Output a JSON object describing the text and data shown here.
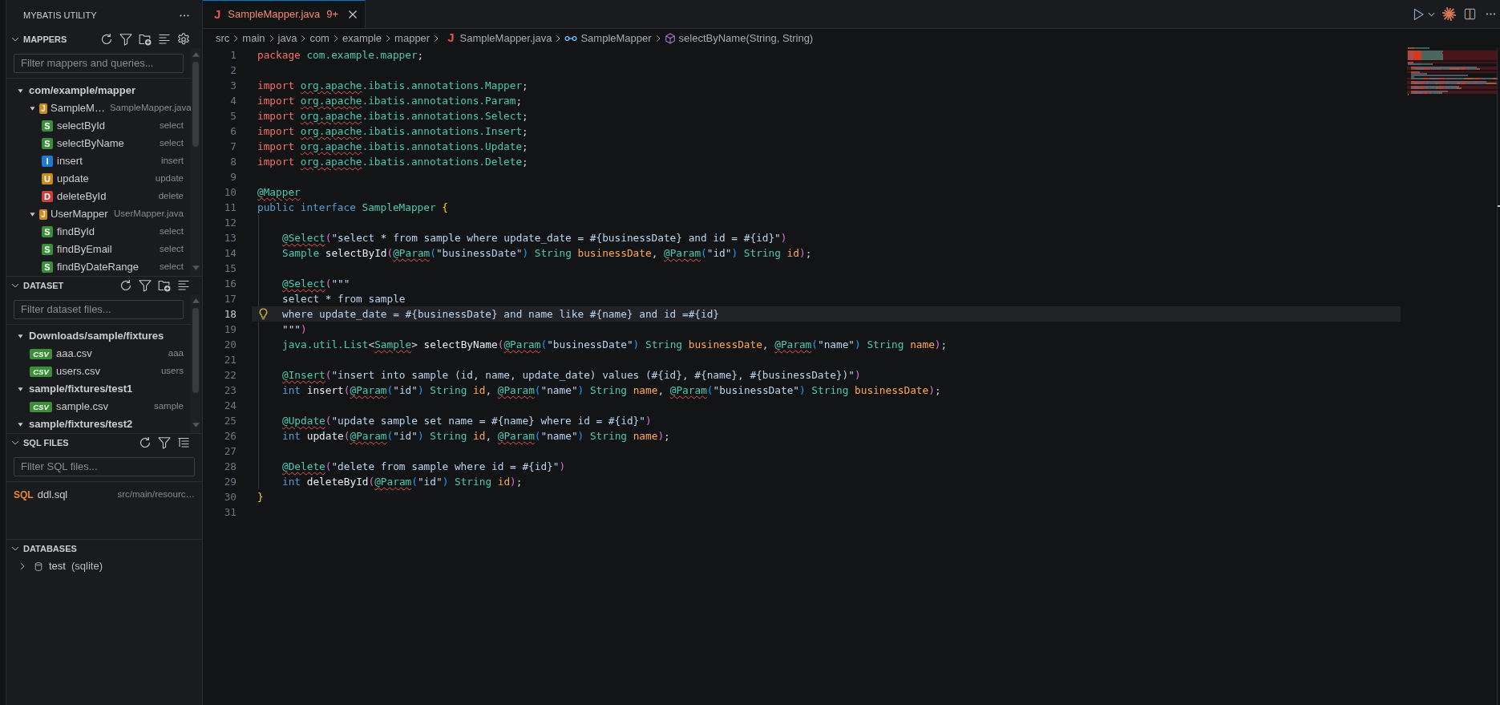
{
  "sidebar": {
    "title": "MYBATIS UTILITY",
    "sections": [
      {
        "kind": "mappers",
        "title": "MAPPERS",
        "expanded": true,
        "filter": {
          "placeholder": "Filter mappers and queries..."
        },
        "tree": [
          {
            "kind": "folder",
            "label": "com/example/mapper",
            "expanded": true,
            "children": [
              {
                "kind": "mapper",
                "badge": "J",
                "label": "SampleM…",
                "detail": "SampleMapper.java",
                "expanded": true,
                "children": [
                  {
                    "kind": "query",
                    "badge": "S",
                    "color": "#3b8e3b",
                    "label": "selectById",
                    "detail": "select"
                  },
                  {
                    "kind": "query",
                    "badge": "S",
                    "color": "#3b8e3b",
                    "label": "selectByName",
                    "detail": "select"
                  },
                  {
                    "kind": "query",
                    "badge": "I",
                    "color": "#1f78d1",
                    "label": "insert",
                    "detail": "insert"
                  },
                  {
                    "kind": "query",
                    "badge": "U",
                    "color": "#c98a1e",
                    "label": "update",
                    "detail": "update"
                  },
                  {
                    "kind": "query",
                    "badge": "D",
                    "color": "#c8413b",
                    "label": "deleteById",
                    "detail": "delete"
                  }
                ]
              },
              {
                "kind": "mapper",
                "badge": "J",
                "label": "UserMapper",
                "detail": "UserMapper.java",
                "expanded": true,
                "children": [
                  {
                    "kind": "query",
                    "badge": "S",
                    "color": "#3b8e3b",
                    "label": "findById",
                    "detail": "select"
                  },
                  {
                    "kind": "query",
                    "badge": "S",
                    "color": "#3b8e3b",
                    "label": "findByEmail",
                    "detail": "select"
                  },
                  {
                    "kind": "query",
                    "badge": "S",
                    "color": "#3b8e3b",
                    "label": "findByDateRange",
                    "detail": "select"
                  }
                ]
              }
            ]
          }
        ]
      },
      {
        "kind": "dataset",
        "title": "DATASET",
        "expanded": true,
        "filter": {
          "placeholder": "Filter dataset files..."
        },
        "tree": [
          {
            "kind": "folder",
            "label": "Downloads/sample/fixtures",
            "expanded": true,
            "children": [
              {
                "kind": "csv",
                "badge": "CSV",
                "label": "aaa.csv",
                "detail": "aaa"
              },
              {
                "kind": "csv",
                "badge": "CSV",
                "label": "users.csv",
                "detail": "users"
              }
            ]
          },
          {
            "kind": "folder",
            "label": "sample/fixtures/test1",
            "expanded": true,
            "children": [
              {
                "kind": "csv",
                "badge": "CSV",
                "label": "sample.csv",
                "detail": "sample"
              }
            ]
          },
          {
            "kind": "folder",
            "label": "sample/fixtures/test2",
            "expanded": true
          }
        ]
      },
      {
        "kind": "sqlfiles",
        "title": "SQL FILES",
        "expanded": true,
        "filter": {
          "placeholder": "Filter SQL files..."
        },
        "tree": [
          {
            "kind": "sql",
            "badge": "SQL",
            "label": "ddl.sql",
            "detail": "src/main/resourc…"
          }
        ]
      },
      {
        "kind": "databases",
        "title": "DATABASES",
        "expanded": true,
        "tree": [
          {
            "kind": "database",
            "label": "test",
            "detail": "(sqlite)",
            "expanded": false
          }
        ]
      }
    ]
  },
  "editor": {
    "tabs": [
      {
        "file_icon": "J",
        "title": "SampleMapper.java",
        "problems": "9+",
        "selected": true
      }
    ],
    "breadcrumbs": [
      {
        "kind": "folder",
        "label": "src"
      },
      {
        "kind": "folder",
        "label": "main"
      },
      {
        "kind": "folder",
        "label": "java"
      },
      {
        "kind": "folder",
        "label": "com"
      },
      {
        "kind": "folder",
        "label": "example"
      },
      {
        "kind": "folder",
        "label": "mapper"
      },
      {
        "kind": "file",
        "file_icon": "J",
        "label": "SampleMapper.java"
      },
      {
        "kind": "interface",
        "label": "SampleMapper"
      },
      {
        "kind": "method",
        "label": "selectByName(String, String)"
      }
    ],
    "lines": [
      {
        "number": "1",
        "current": false,
        "lightbulb": false,
        "tokens": [
          {
            "text": "package ",
            "kind": "keyword"
          },
          {
            "text": "com.example.mapper",
            "kind": "namespace"
          },
          {
            "text": ";",
            "kind": "plain"
          }
        ]
      },
      {
        "number": "2",
        "current": false,
        "lightbulb": false
      },
      {
        "number": "3",
        "current": false,
        "lightbulb": false,
        "tokens": [
          {
            "text": "import ",
            "kind": "keyword"
          },
          {
            "text": "org.apache",
            "kind": "unresolved"
          },
          {
            "text": ".ibatis.annotations.Mapper",
            "kind": "namespace"
          },
          {
            "text": ";",
            "kind": "plain"
          }
        ]
      },
      {
        "number": "4",
        "current": false,
        "lightbulb": false,
        "tokens": [
          {
            "text": "import ",
            "kind": "keyword"
          },
          {
            "text": "org.apache",
            "kind": "unresolved"
          },
          {
            "text": ".ibatis.annotations.Param",
            "kind": "namespace"
          },
          {
            "text": ";",
            "kind": "plain"
          }
        ]
      },
      {
        "number": "5",
        "current": false,
        "lightbulb": false,
        "tokens": [
          {
            "text": "import ",
            "kind": "keyword"
          },
          {
            "text": "org.apache",
            "kind": "unresolved"
          },
          {
            "text": ".ibatis.annotations.Select",
            "kind": "namespace"
          },
          {
            "text": ";",
            "kind": "plain"
          }
        ]
      },
      {
        "number": "6",
        "current": false,
        "lightbulb": false,
        "tokens": [
          {
            "text": "import ",
            "kind": "keyword"
          },
          {
            "text": "org.apache",
            "kind": "unresolved"
          },
          {
            "text": ".ibatis.annotations.Insert",
            "kind": "namespace"
          },
          {
            "text": ";",
            "kind": "plain"
          }
        ]
      },
      {
        "number": "7",
        "current": false,
        "lightbulb": false,
        "tokens": [
          {
            "text": "import ",
            "kind": "keyword"
          },
          {
            "text": "org.apache",
            "kind": "unresolved"
          },
          {
            "text": ".ibatis.annotations.Update",
            "kind": "namespace"
          },
          {
            "text": ";",
            "kind": "plain"
          }
        ]
      },
      {
        "number": "8",
        "current": false,
        "lightbulb": false,
        "tokens": [
          {
            "text": "import ",
            "kind": "keyword"
          },
          {
            "text": "org.apache",
            "kind": "unresolved"
          },
          {
            "text": ".ibatis.annotations.Delete",
            "kind": "namespace"
          },
          {
            "text": ";",
            "kind": "plain"
          }
        ]
      },
      {
        "number": "9",
        "current": false,
        "lightbulb": false
      },
      {
        "number": "10",
        "current": false,
        "lightbulb": false,
        "tokens": [
          {
            "text": "@Mapper",
            "kind": "unresolved"
          }
        ]
      },
      {
        "number": "11",
        "current": false,
        "lightbulb": false,
        "tokens": [
          {
            "text": "public interface ",
            "kind": "storage"
          },
          {
            "text": "SampleMapper ",
            "kind": "type"
          },
          {
            "text": "{",
            "kind": "bracket1"
          }
        ],
        "children": [
          {
            "number": "12",
            "current": false,
            "lightbulb": false
          },
          {
            "number": "13",
            "current": false,
            "lightbulb": false,
            "tokens": [
              {
                "text": "@Select",
                "kind": "unresolved"
              },
              {
                "text": "(",
                "kind": "bracket2"
              },
              {
                "text": "\"select * from sample where update_date = #{businessDate} and id = #{id}\"",
                "kind": "string"
              },
              {
                "text": ")",
                "kind": "bracket2"
              }
            ]
          },
          {
            "number": "14",
            "current": false,
            "lightbulb": false,
            "tokens": [
              {
                "text": "Sample ",
                "kind": "type"
              },
              {
                "text": "selectById",
                "kind": "method"
              },
              {
                "text": "(",
                "kind": "bracket2"
              },
              {
                "text": "@Param",
                "kind": "unresolved"
              },
              {
                "text": "(",
                "kind": "bracket3"
              },
              {
                "text": "\"businessDate\"",
                "kind": "string"
              },
              {
                "text": ")",
                "kind": "bracket3"
              },
              {
                "text": " String ",
                "kind": "type"
              },
              {
                "text": "businessDate",
                "kind": "param"
              },
              {
                "text": ", ",
                "kind": "plain"
              },
              {
                "text": "@Param",
                "kind": "unresolved"
              },
              {
                "text": "(",
                "kind": "bracket3"
              },
              {
                "text": "\"id\"",
                "kind": "string"
              },
              {
                "text": ")",
                "kind": "bracket3"
              },
              {
                "text": " String ",
                "kind": "type"
              },
              {
                "text": "id",
                "kind": "param"
              },
              {
                "text": ")",
                "kind": "bracket2"
              },
              {
                "text": ";",
                "kind": "plain"
              }
            ]
          },
          {
            "number": "15",
            "current": false,
            "lightbulb": false
          },
          {
            "number": "16",
            "current": false,
            "lightbulb": false,
            "tokens": [
              {
                "text": "@Select",
                "kind": "unresolved"
              },
              {
                "text": "(",
                "kind": "bracket2"
              },
              {
                "text": "\"\"\"",
                "kind": "string"
              }
            ]
          },
          {
            "number": "17",
            "current": false,
            "lightbulb": false,
            "tokens": [
              {
                "text": "select * from sample",
                "kind": "string"
              }
            ]
          },
          {
            "number": "18",
            "current": true,
            "lightbulb": true,
            "tokens": [
              {
                "text": "where update_date = #{businessDate} and name like #{name} and id =#{id}",
                "kind": "string"
              }
            ]
          },
          {
            "number": "19",
            "current": false,
            "lightbulb": false,
            "tokens": [
              {
                "text": "\"\"\"",
                "kind": "string"
              },
              {
                "text": ")",
                "kind": "bracket2"
              }
            ]
          },
          {
            "number": "20",
            "current": false,
            "lightbulb": false,
            "tokens": [
              {
                "text": "java.util.List",
                "kind": "type"
              },
              {
                "text": "<",
                "kind": "plain"
              },
              {
                "text": "Sample",
                "kind": "unresolved"
              },
              {
                "text": "> ",
                "kind": "plain"
              },
              {
                "text": "selectByName",
                "kind": "method"
              },
              {
                "text": "(",
                "kind": "bracket2"
              },
              {
                "text": "@Param",
                "kind": "unresolved"
              },
              {
                "text": "(",
                "kind": "bracket3"
              },
              {
                "text": "\"businessDate\"",
                "kind": "string"
              },
              {
                "text": ")",
                "kind": "bracket3"
              },
              {
                "text": " String ",
                "kind": "type"
              },
              {
                "text": "businessDate",
                "kind": "param"
              },
              {
                "text": ", ",
                "kind": "plain"
              },
              {
                "text": "@Param",
                "kind": "unresolved"
              },
              {
                "text": "(",
                "kind": "bracket3"
              },
              {
                "text": "\"name\"",
                "kind": "string"
              },
              {
                "text": ")",
                "kind": "bracket3"
              },
              {
                "text": " String ",
                "kind": "type"
              },
              {
                "text": "name",
                "kind": "param"
              },
              {
                "text": ")",
                "kind": "bracket2"
              },
              {
                "text": ";",
                "kind": "plain"
              }
            ]
          },
          {
            "number": "21",
            "current": false,
            "lightbulb": false
          },
          {
            "number": "22",
            "current": false,
            "lightbulb": false,
            "tokens": [
              {
                "text": "@Insert",
                "kind": "unresolved"
              },
              {
                "text": "(",
                "kind": "bracket2"
              },
              {
                "text": "\"insert into sample (id, name, update_date) values (#{id}, #{name}, #{businessDate})\"",
                "kind": "string"
              },
              {
                "text": ")",
                "kind": "bracket2"
              }
            ]
          },
          {
            "number": "23",
            "current": false,
            "lightbulb": false,
            "tokens": [
              {
                "text": "int ",
                "kind": "storage"
              },
              {
                "text": "insert",
                "kind": "method"
              },
              {
                "text": "(",
                "kind": "bracket2"
              },
              {
                "text": "@Param",
                "kind": "unresolved"
              },
              {
                "text": "(",
                "kind": "bracket3"
              },
              {
                "text": "\"id\"",
                "kind": "string"
              },
              {
                "text": ")",
                "kind": "bracket3"
              },
              {
                "text": " String ",
                "kind": "type"
              },
              {
                "text": "id",
                "kind": "param"
              },
              {
                "text": ", ",
                "kind": "plain"
              },
              {
                "text": "@Param",
                "kind": "unresolved"
              },
              {
                "text": "(",
                "kind": "bracket3"
              },
              {
                "text": "\"name\"",
                "kind": "string"
              },
              {
                "text": ")",
                "kind": "bracket3"
              },
              {
                "text": " String ",
                "kind": "type"
              },
              {
                "text": "name",
                "kind": "param"
              },
              {
                "text": ", ",
                "kind": "plain"
              },
              {
                "text": "@Param",
                "kind": "unresolved"
              },
              {
                "text": "(",
                "kind": "bracket3"
              },
              {
                "text": "\"businessDate\"",
                "kind": "string"
              },
              {
                "text": ")",
                "kind": "bracket3"
              },
              {
                "text": " String ",
                "kind": "type"
              },
              {
                "text": "businessDate",
                "kind": "param"
              },
              {
                "text": ")",
                "kind": "bracket2"
              },
              {
                "text": ";",
                "kind": "plain"
              }
            ]
          },
          {
            "number": "24",
            "current": false,
            "lightbulb": false
          },
          {
            "number": "25",
            "current": false,
            "lightbulb": false,
            "tokens": [
              {
                "text": "@Update",
                "kind": "unresolved"
              },
              {
                "text": "(",
                "kind": "bracket2"
              },
              {
                "text": "\"update sample set name = #{name} where id = #{id}\"",
                "kind": "string"
              },
              {
                "text": ")",
                "kind": "bracket2"
              }
            ]
          },
          {
            "number": "26",
            "current": false,
            "lightbulb": false,
            "tokens": [
              {
                "text": "int ",
                "kind": "storage"
              },
              {
                "text": "update",
                "kind": "method"
              },
              {
                "text": "(",
                "kind": "bracket2"
              },
              {
                "text": "@Param",
                "kind": "unresolved"
              },
              {
                "text": "(",
                "kind": "bracket3"
              },
              {
                "text": "\"id\"",
                "kind": "string"
              },
              {
                "text": ")",
                "kind": "bracket3"
              },
              {
                "text": " String ",
                "kind": "type"
              },
              {
                "text": "id",
                "kind": "param"
              },
              {
                "text": ", ",
                "kind": "plain"
              },
              {
                "text": "@Param",
                "kind": "unresolved"
              },
              {
                "text": "(",
                "kind": "bracket3"
              },
              {
                "text": "\"name\"",
                "kind": "string"
              },
              {
                "text": ")",
                "kind": "bracket3"
              },
              {
                "text": " String ",
                "kind": "type"
              },
              {
                "text": "name",
                "kind": "param"
              },
              {
                "text": ")",
                "kind": "bracket2"
              },
              {
                "text": ";",
                "kind": "plain"
              }
            ]
          },
          {
            "number": "27",
            "current": false,
            "lightbulb": false
          },
          {
            "number": "28",
            "current": false,
            "lightbulb": false,
            "tokens": [
              {
                "text": "@Delete",
                "kind": "unresolved"
              },
              {
                "text": "(",
                "kind": "bracket2"
              },
              {
                "text": "\"delete from sample where id = #{id}\"",
                "kind": "string"
              },
              {
                "text": ")",
                "kind": "bracket2"
              }
            ]
          },
          {
            "number": "29",
            "current": false,
            "lightbulb": false,
            "tokens": [
              {
                "text": "int ",
                "kind": "storage"
              },
              {
                "text": "deleteById",
                "kind": "method"
              },
              {
                "text": "(",
                "kind": "bracket2"
              },
              {
                "text": "@Param",
                "kind": "unresolved"
              },
              {
                "text": "(",
                "kind": "bracket3"
              },
              {
                "text": "\"id\"",
                "kind": "string"
              },
              {
                "text": ")",
                "kind": "bracket3"
              },
              {
                "text": " String ",
                "kind": "type"
              },
              {
                "text": "id",
                "kind": "param"
              },
              {
                "text": ")",
                "kind": "bracket2"
              },
              {
                "text": ";",
                "kind": "plain"
              }
            ]
          }
        ]
      },
      {
        "number": "30",
        "current": false,
        "lightbulb": false,
        "tokens": [
          {
            "text": "}",
            "kind": "bracket1"
          }
        ]
      },
      {
        "number": "31",
        "current": false,
        "lightbulb": false
      }
    ]
  }
}
